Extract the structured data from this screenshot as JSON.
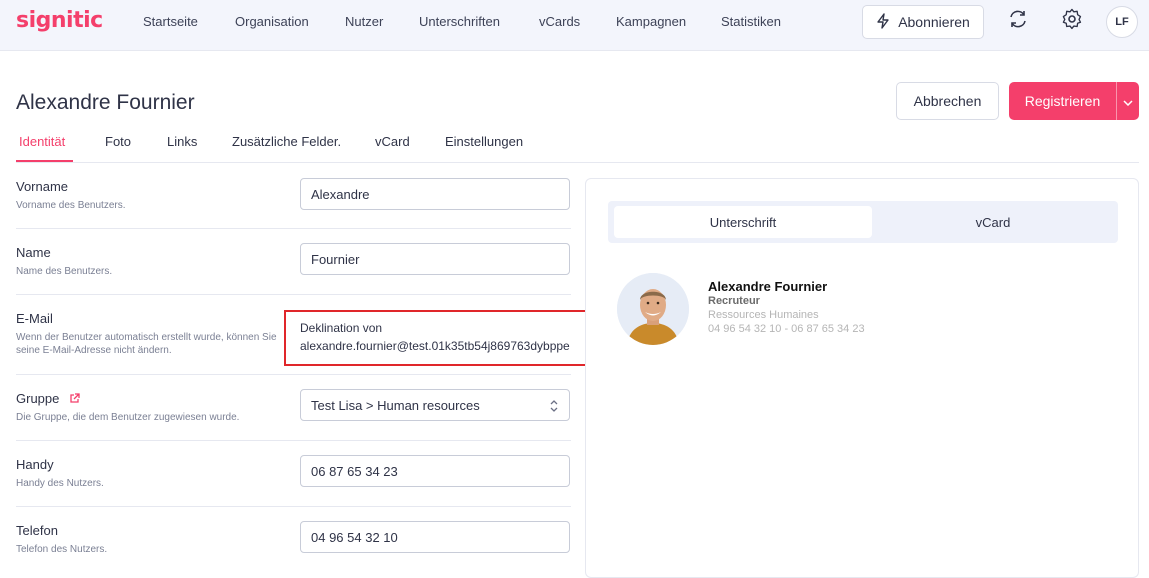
{
  "brand": {
    "logo": "signitic",
    "accent": "#f43f6b"
  },
  "nav": {
    "items": [
      "Startseite",
      "Organisation",
      "Nutzer",
      "Unterschriften",
      "vCards",
      "Kampagnen",
      "Statistiken"
    ],
    "subscribe_label": "Abonnieren",
    "avatar_initials": "LF"
  },
  "page": {
    "title": "Alexandre Fournier",
    "cancel_label": "Abbrechen",
    "register_label": "Registrieren"
  },
  "tabs": [
    "Identität",
    "Foto",
    "Links",
    "Zusätzliche Felder.",
    "vCard",
    "Einstellungen"
  ],
  "form": {
    "firstname": {
      "label": "Vorname",
      "desc": "Vorname des Benutzers.",
      "value": "Alexandre"
    },
    "lastname": {
      "label": "Name",
      "desc": "Name des Benutzers.",
      "value": "Fournier"
    },
    "email": {
      "label": "E-Mail",
      "desc": "Wenn der Benutzer automatisch erstellt wurde, können Sie seine E-Mail-Adresse nicht ändern.",
      "line1": "Deklination von",
      "line2": "alexandre.fournier@test.01k35tb54j869763dybppe"
    },
    "group": {
      "label": "Gruppe",
      "desc": "Die Gruppe, die dem Benutzer zugewiesen wurde.",
      "value": "Test Lisa > Human resources"
    },
    "mobile": {
      "label": "Handy",
      "desc": "Handy des Nutzers.",
      "value": "06 87 65 34 23"
    },
    "phone": {
      "label": "Telefon",
      "desc": "Telefon des Nutzers.",
      "value": "04 96 54 32 10"
    }
  },
  "preview": {
    "tabs": [
      "Unterschrift",
      "vCard"
    ],
    "signature": {
      "name": "Alexandre Fournier",
      "role": "Recruteur",
      "department": "Ressources Humaines",
      "phones": "04 96 54 32 10 - 06 87 65 34 23"
    }
  },
  "icons": {
    "subscribe": "lightning-icon",
    "sync": "sync-icon",
    "settings": "gear-icon",
    "dropdown": "chevron-down-icon",
    "external": "external-link-icon",
    "select": "select-updown-icon"
  }
}
